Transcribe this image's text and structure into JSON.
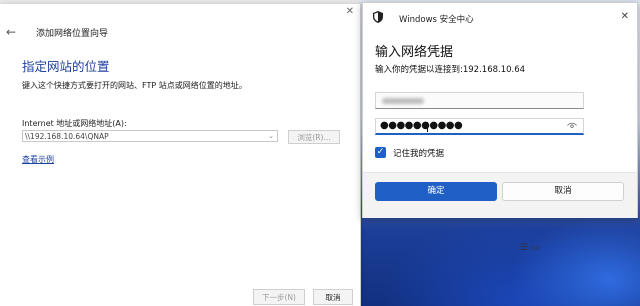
{
  "wizard": {
    "window_title": "添加网络位置向导",
    "heading": "指定网站的位置",
    "description": "键入这个快捷方式要打开的网站、FTP 站点或网络位置的地址。",
    "address_label": "Internet 地址或网络地址(A):",
    "address_value": "\\\\192.168.10.64\\QNAP",
    "browse_label": "浏览(R)...",
    "example_link": "查看示例",
    "next_label": "下一步(N)",
    "cancel_label": "取消"
  },
  "dialog": {
    "app_name": "Windows 安全中心",
    "heading": "输入网络凭据",
    "subtitle": "输入你的凭据以连接到:192.168.10.64",
    "password_mask": "●●●●●●●●●●",
    "remember_label": "记住我的凭据",
    "remember_checked": true,
    "ok_label": "确定",
    "cancel_label": "取消"
  },
  "colors": {
    "accent": "#1f5fc6",
    "heading_blue": "#1e3f9c"
  },
  "icons": [
    "back-arrow-icon",
    "close-icon",
    "shield-icon",
    "eye-icon",
    "checkmark-icon",
    "chevron-down-icon"
  ]
}
